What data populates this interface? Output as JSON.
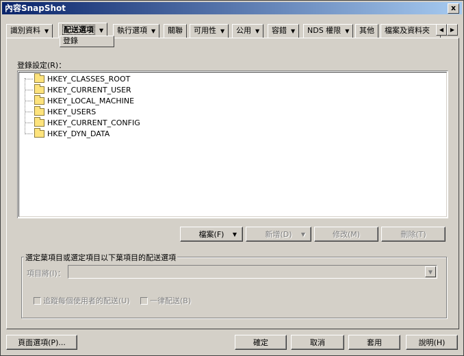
{
  "window": {
    "title": "內容SnapShot",
    "close": "x"
  },
  "tabs": [
    {
      "label": "識別資料",
      "arrow": "▼"
    },
    {
      "label": "配送選項",
      "arrow": "▼"
    },
    {
      "label": "執行選項",
      "arrow": "▼"
    },
    {
      "label": "關聯",
      "arrow": ""
    },
    {
      "label": "可用性",
      "arrow": "▼"
    },
    {
      "label": "公用",
      "arrow": "▼"
    },
    {
      "label": "容錯",
      "arrow": "▼"
    },
    {
      "label": "NDS 權限",
      "arrow": "▼"
    },
    {
      "label": "其他",
      "arrow": ""
    },
    {
      "label": "檔案及資料夾",
      "arrow": ""
    }
  ],
  "subtab": "登錄",
  "registry": {
    "label": "登錄設定(R)：",
    "keys": [
      "HKEY_CLASSES_ROOT",
      "HKEY_CURRENT_USER",
      "HKEY_LOCAL_MACHINE",
      "HKEY_USERS",
      "HKEY_CURRENT_CONFIG",
      "HKEY_DYN_DATA"
    ]
  },
  "actions": {
    "file": "檔案(F)",
    "add": "新增(D)",
    "modify": "修改(M)",
    "delete": "刪除(T)"
  },
  "group": {
    "title": "選定葉項目或選定項目以下葉項目的配送選項",
    "item_label": "項目將(I)：",
    "track": "追蹤每個使用者的配送(U)",
    "always": "一律配送(B)"
  },
  "footer": {
    "page_options": "頁面選項(P)...",
    "ok": "確定",
    "cancel": "取消",
    "apply": "套用",
    "help": "說明(H)"
  }
}
